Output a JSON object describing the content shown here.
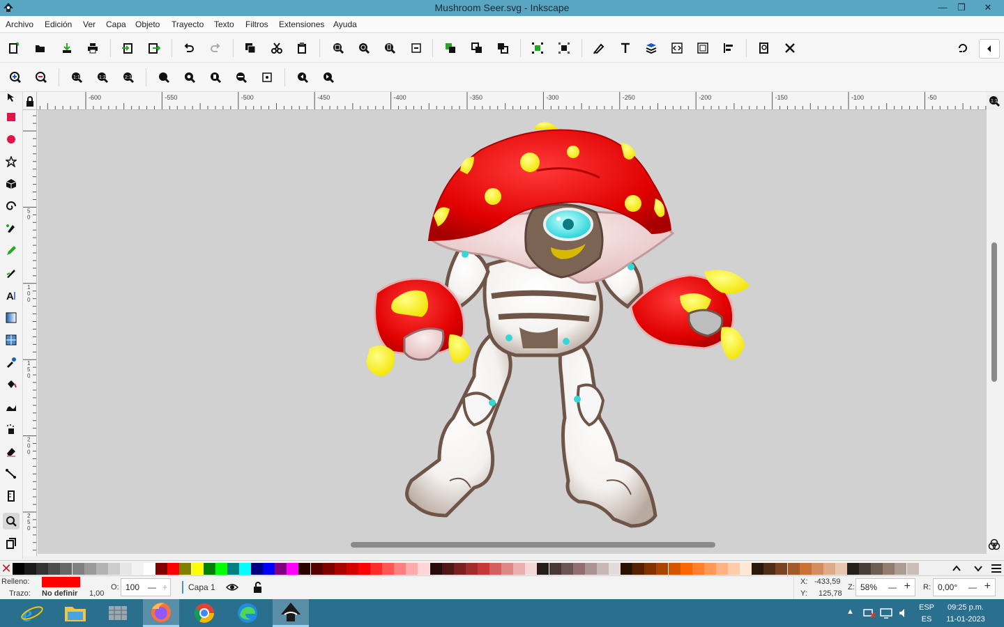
{
  "window": {
    "title": "Mushroom Seer.svg - Inkscape",
    "minimize": "—",
    "maximize": "❐",
    "close": "✕"
  },
  "menu": [
    "Archivo",
    "Edición",
    "Ver",
    "Capa",
    "Objeto",
    "Trayecto",
    "Texto",
    "Filtros",
    "Extensiones",
    "Ayuda"
  ],
  "ruler": {
    "h_labels": [
      "-600",
      "-550",
      "-500",
      "-450",
      "-400",
      "-350",
      "-300",
      "-250",
      "-200",
      "-150",
      "-100",
      "-50"
    ],
    "v_labels": [
      "5\n0",
      "1\n0\n0",
      "1\n5\n0",
      "2\n0\n0",
      "2\n5\n0"
    ]
  },
  "palette": {
    "none_symbol": "✕",
    "colors": [
      "#000000",
      "#1a1a1a",
      "#333333",
      "#4d4d4d",
      "#666666",
      "#808080",
      "#999999",
      "#b3b3b3",
      "#cccccc",
      "#e6e6e6",
      "#f2f2f2",
      "#ffffff",
      "#800000",
      "#ff0000",
      "#808000",
      "#ffff00",
      "#008000",
      "#00ff00",
      "#008080",
      "#00ffff",
      "#000080",
      "#0000ff",
      "#800080",
      "#ff00ff",
      "#2b0000",
      "#550000",
      "#800000",
      "#aa0000",
      "#d40000",
      "#ff0000",
      "#ff2a2a",
      "#ff5555",
      "#ff8080",
      "#ffaaaa",
      "#ffd5d5",
      "#280b0b",
      "#501616",
      "#782121",
      "#a02c2c",
      "#c83737",
      "#d35f5f",
      "#de8787",
      "#e9afaf",
      "#f4d7d7",
      "#241c1c",
      "#483737",
      "#6c5353",
      "#916f6f",
      "#ac9393",
      "#c8b7b7",
      "#e3dbdb",
      "#2b1100",
      "#552200",
      "#803300",
      "#aa4400",
      "#d45500",
      "#ff6600",
      "#ff7f2a",
      "#ff9955",
      "#ffb380",
      "#ffccaa",
      "#ffe6d5",
      "#28170b",
      "#502d16",
      "#784421",
      "#a05a2c",
      "#c87137",
      "#d38d5f",
      "#deaa87",
      "#e9c6af",
      "#241f1c",
      "#483e37",
      "#6c5d53",
      "#917c6f",
      "#ac9d93",
      "#c8beb7"
    ]
  },
  "status": {
    "fill_label": "Relleno:",
    "fill_color": "#ff0000",
    "stroke_label": "Trazo:",
    "stroke_value": "No definir",
    "stroke_width": "1,00",
    "opacity_label": "O:",
    "opacity_value": "100",
    "layer": "Capa 1",
    "x_label": "X:",
    "x_value": "-433,59",
    "y_label": "Y:",
    "y_value": "125,78",
    "zoom_label": "Z:",
    "zoom_value": "58%",
    "rotate_label": "R:",
    "rotate_value": "0,00°"
  },
  "taskbar": {
    "lang1": "ESP",
    "lang2": "ES",
    "time": "09:25 p.m.",
    "date": "11-01-2023"
  },
  "colors": {
    "titlebar": "#58a6c2",
    "taskbar": "#2b6f8f",
    "canvas": "#d1d1d1"
  }
}
